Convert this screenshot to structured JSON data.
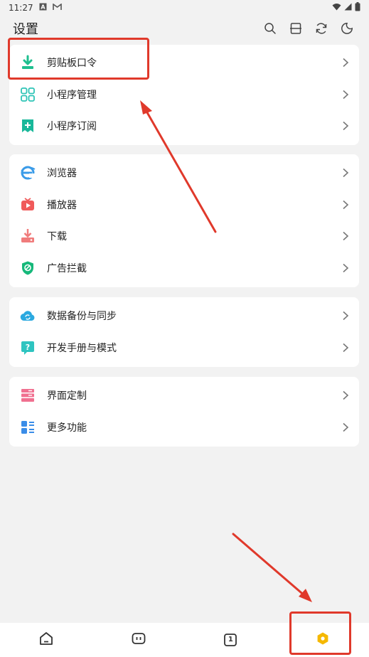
{
  "status_bar": {
    "time": "11:27",
    "icons": [
      "a-notification-icon",
      "gmail-icon",
      "wifi-icon",
      "signal-icon",
      "battery-icon"
    ]
  },
  "header": {
    "title": "设置",
    "actions": [
      "search-icon",
      "scan-icon",
      "refresh-icon",
      "night-mode-icon"
    ]
  },
  "groups": [
    {
      "items": [
        {
          "label": "剪贴板口令",
          "icon": "clipboard-download-icon",
          "color": "#1fbf8f"
        },
        {
          "label": "小程序管理",
          "icon": "mini-program-grid-icon",
          "color": "#2ec4b6"
        },
        {
          "label": "小程序订阅",
          "icon": "subscribe-icon",
          "color": "#19b89a"
        }
      ]
    },
    {
      "items": [
        {
          "label": "浏览器",
          "icon": "browser-icon",
          "color": "#3a9be8"
        },
        {
          "label": "播放器",
          "icon": "player-icon",
          "color": "#f05a5a"
        },
        {
          "label": "下载",
          "icon": "download-icon",
          "color": "#f07c7c"
        },
        {
          "label": "广告拦截",
          "icon": "ad-block-shield-icon",
          "color": "#16b87a"
        }
      ]
    },
    {
      "items": [
        {
          "label": "数据备份与同步",
          "icon": "cloud-sync-icon",
          "color": "#2ba9e0"
        },
        {
          "label": "开发手册与模式",
          "icon": "help-bubble-icon",
          "color": "#2ec4c0"
        }
      ]
    },
    {
      "items": [
        {
          "label": "界面定制",
          "icon": "ui-customize-icon",
          "color": "#f07090"
        },
        {
          "label": "更多功能",
          "icon": "more-features-icon",
          "color": "#3a8de8"
        }
      ]
    }
  ],
  "bottom_nav": [
    {
      "icon": "home-icon"
    },
    {
      "icon": "mini-program-icon"
    },
    {
      "icon": "tabs-count-icon",
      "count": "1"
    },
    {
      "icon": "settings-gear-icon",
      "color": "#f5b800"
    }
  ],
  "colors": {
    "annotation": "#e0392b",
    "accent": "#f5b800"
  }
}
